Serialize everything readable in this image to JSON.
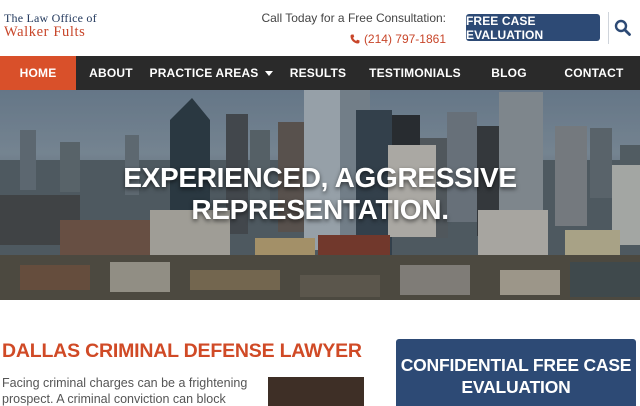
{
  "header": {
    "logo": {
      "line1": "The Law Office of",
      "line2": "Walker Fults"
    },
    "consult_label": "Call Today for a Free Consultation:",
    "phone": "(214) 797-1861",
    "cta_button": "FREE CASE EVALUATION",
    "search_icon": "search-icon",
    "phone_icon": "phone-icon"
  },
  "nav": {
    "items": [
      {
        "label": "HOME",
        "active": true
      },
      {
        "label": "ABOUT"
      },
      {
        "label": "PRACTICE AREAS",
        "has_dropdown": true
      },
      {
        "label": "RESULTS"
      },
      {
        "label": "TESTIMONIALS"
      },
      {
        "label": "BLOG"
      },
      {
        "label": "CONTACT"
      }
    ]
  },
  "hero": {
    "headline": "EXPERIENCED, AGGRESSIVE REPRESENTATION."
  },
  "main": {
    "title": "DALLAS CRIMINAL DEFENSE LAWYER",
    "paragraph": "Facing criminal charges can be a frightening prospect. A criminal conviction can block work"
  },
  "form": {
    "title": "CONFIDENTIAL FREE CASE EVALUATION"
  },
  "colors": {
    "navy": "#2d4a75",
    "accent": "#d9502a",
    "nav_bg": "#2a2a2a"
  }
}
